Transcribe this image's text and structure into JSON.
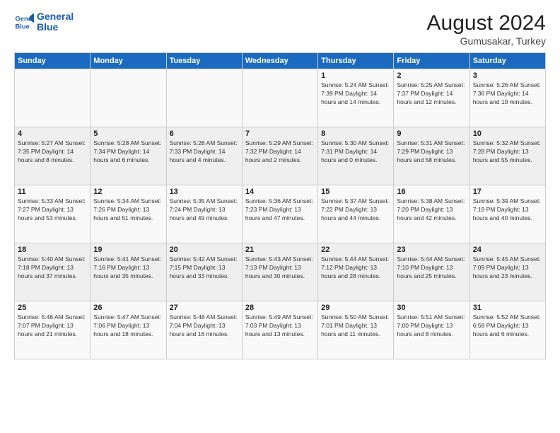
{
  "header": {
    "logo_line1": "General",
    "logo_line2": "Blue",
    "month_year": "August 2024",
    "location": "Gumusakar, Turkey"
  },
  "weekdays": [
    "Sunday",
    "Monday",
    "Tuesday",
    "Wednesday",
    "Thursday",
    "Friday",
    "Saturday"
  ],
  "weeks": [
    [
      {
        "day": "",
        "info": ""
      },
      {
        "day": "",
        "info": ""
      },
      {
        "day": "",
        "info": ""
      },
      {
        "day": "",
        "info": ""
      },
      {
        "day": "1",
        "info": "Sunrise: 5:24 AM\nSunset: 7:39 PM\nDaylight: 14 hours\nand 14 minutes."
      },
      {
        "day": "2",
        "info": "Sunrise: 5:25 AM\nSunset: 7:37 PM\nDaylight: 14 hours\nand 12 minutes."
      },
      {
        "day": "3",
        "info": "Sunrise: 5:26 AM\nSunset: 7:36 PM\nDaylight: 14 hours\nand 10 minutes."
      }
    ],
    [
      {
        "day": "4",
        "info": "Sunrise: 5:27 AM\nSunset: 7:35 PM\nDaylight: 14 hours\nand 8 minutes."
      },
      {
        "day": "5",
        "info": "Sunrise: 5:28 AM\nSunset: 7:34 PM\nDaylight: 14 hours\nand 6 minutes."
      },
      {
        "day": "6",
        "info": "Sunrise: 5:28 AM\nSunset: 7:33 PM\nDaylight: 14 hours\nand 4 minutes."
      },
      {
        "day": "7",
        "info": "Sunrise: 5:29 AM\nSunset: 7:32 PM\nDaylight: 14 hours\nand 2 minutes."
      },
      {
        "day": "8",
        "info": "Sunrise: 5:30 AM\nSunset: 7:31 PM\nDaylight: 14 hours\nand 0 minutes."
      },
      {
        "day": "9",
        "info": "Sunrise: 5:31 AM\nSunset: 7:29 PM\nDaylight: 13 hours\nand 58 minutes."
      },
      {
        "day": "10",
        "info": "Sunrise: 5:32 AM\nSunset: 7:28 PM\nDaylight: 13 hours\nand 55 minutes."
      }
    ],
    [
      {
        "day": "11",
        "info": "Sunrise: 5:33 AM\nSunset: 7:27 PM\nDaylight: 13 hours\nand 53 minutes."
      },
      {
        "day": "12",
        "info": "Sunrise: 5:34 AM\nSunset: 7:26 PM\nDaylight: 13 hours\nand 51 minutes."
      },
      {
        "day": "13",
        "info": "Sunrise: 5:35 AM\nSunset: 7:24 PM\nDaylight: 13 hours\nand 49 minutes."
      },
      {
        "day": "14",
        "info": "Sunrise: 5:36 AM\nSunset: 7:23 PM\nDaylight: 13 hours\nand 47 minutes."
      },
      {
        "day": "15",
        "info": "Sunrise: 5:37 AM\nSunset: 7:22 PM\nDaylight: 13 hours\nand 44 minutes."
      },
      {
        "day": "16",
        "info": "Sunrise: 5:38 AM\nSunset: 7:20 PM\nDaylight: 13 hours\nand 42 minutes."
      },
      {
        "day": "17",
        "info": "Sunrise: 5:39 AM\nSunset: 7:19 PM\nDaylight: 13 hours\nand 40 minutes."
      }
    ],
    [
      {
        "day": "18",
        "info": "Sunrise: 5:40 AM\nSunset: 7:18 PM\nDaylight: 13 hours\nand 37 minutes."
      },
      {
        "day": "19",
        "info": "Sunrise: 5:41 AM\nSunset: 7:16 PM\nDaylight: 13 hours\nand 35 minutes."
      },
      {
        "day": "20",
        "info": "Sunrise: 5:42 AM\nSunset: 7:15 PM\nDaylight: 13 hours\nand 33 minutes."
      },
      {
        "day": "21",
        "info": "Sunrise: 5:43 AM\nSunset: 7:13 PM\nDaylight: 13 hours\nand 30 minutes."
      },
      {
        "day": "22",
        "info": "Sunrise: 5:44 AM\nSunset: 7:12 PM\nDaylight: 13 hours\nand 28 minutes."
      },
      {
        "day": "23",
        "info": "Sunrise: 5:44 AM\nSunset: 7:10 PM\nDaylight: 13 hours\nand 25 minutes."
      },
      {
        "day": "24",
        "info": "Sunrise: 5:45 AM\nSunset: 7:09 PM\nDaylight: 13 hours\nand 23 minutes."
      }
    ],
    [
      {
        "day": "25",
        "info": "Sunrise: 5:46 AM\nSunset: 7:07 PM\nDaylight: 13 hours\nand 21 minutes."
      },
      {
        "day": "26",
        "info": "Sunrise: 5:47 AM\nSunset: 7:06 PM\nDaylight: 13 hours\nand 18 minutes."
      },
      {
        "day": "27",
        "info": "Sunrise: 5:48 AM\nSunset: 7:04 PM\nDaylight: 13 hours\nand 16 minutes."
      },
      {
        "day": "28",
        "info": "Sunrise: 5:49 AM\nSunset: 7:03 PM\nDaylight: 13 hours\nand 13 minutes."
      },
      {
        "day": "29",
        "info": "Sunrise: 5:50 AM\nSunset: 7:01 PM\nDaylight: 13 hours\nand 11 minutes."
      },
      {
        "day": "30",
        "info": "Sunrise: 5:51 AM\nSunset: 7:00 PM\nDaylight: 13 hours\nand 8 minutes."
      },
      {
        "day": "31",
        "info": "Sunrise: 5:52 AM\nSunset: 6:58 PM\nDaylight: 13 hours\nand 6 minutes."
      }
    ]
  ]
}
